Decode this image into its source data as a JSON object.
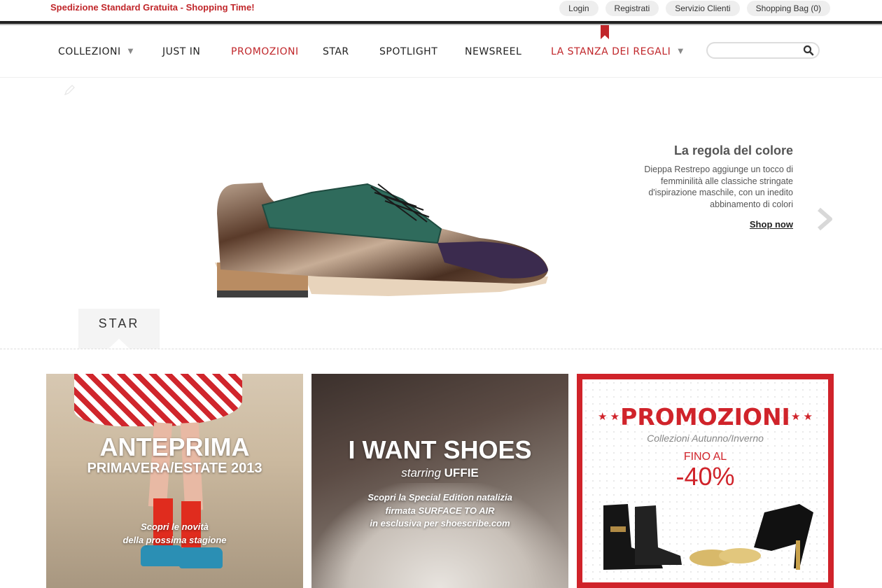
{
  "topbar": {
    "promo_message": "Spedizione Standard Gratuita - Shopping Time!",
    "links": [
      "Login",
      "Registrati",
      "Servizio Clienti",
      "Shopping Bag (0)"
    ]
  },
  "nav": {
    "items": [
      {
        "label": "COLLEZIONI",
        "dropdown": true,
        "color": "#222222"
      },
      {
        "label": "JUST IN",
        "dropdown": false,
        "color": "#222222"
      },
      {
        "label": "PROMOZIONI",
        "dropdown": false,
        "color": "#c0262a"
      },
      {
        "label": "STAR",
        "dropdown": false,
        "color": "#222222"
      },
      {
        "label": "SPOTLIGHT",
        "dropdown": false,
        "color": "#222222"
      },
      {
        "label": "NEWSREEL",
        "dropdown": false,
        "color": "#222222"
      },
      {
        "label": "LA STANZA DEI REGALI",
        "dropdown": true,
        "color": "#c0262a"
      }
    ],
    "search": {
      "placeholder": "",
      "icon": "search-icon"
    }
  },
  "hero": {
    "title": "La regola del colore",
    "description": "Dieppa Restrepo aggiunge un tocco di femminilità alle classiche stringate d'ispirazione maschile, con un inedito abbinamento di colori",
    "cta": "Shop now",
    "tab_label": "STAR",
    "next_icon": "chevron-right-icon"
  },
  "tiles": [
    {
      "title": "ANTEPRIMA",
      "subtitle": "PRIMAVERA/ESTATE 2013",
      "text_line1": "Scopri le novità",
      "text_line2": "della prossima stagione"
    },
    {
      "title": "I WANT SHOES",
      "starring": "starring",
      "starring_name": "UFFIE",
      "text_line1": "Scopri la Special Edition natalizia",
      "text_line2": "firmata SURFACE TO AIR",
      "text_line3": "in esclusiva per shoescribe.com"
    },
    {
      "title": "PROMOZIONI",
      "subtitle": "Collezioni Autunno/Inverno",
      "discount_label": "FINO AL",
      "discount_value": "-40%",
      "accent": "#d0232a"
    }
  ],
  "colors": {
    "accent_red": "#c0262a",
    "text_dark": "#222222"
  }
}
